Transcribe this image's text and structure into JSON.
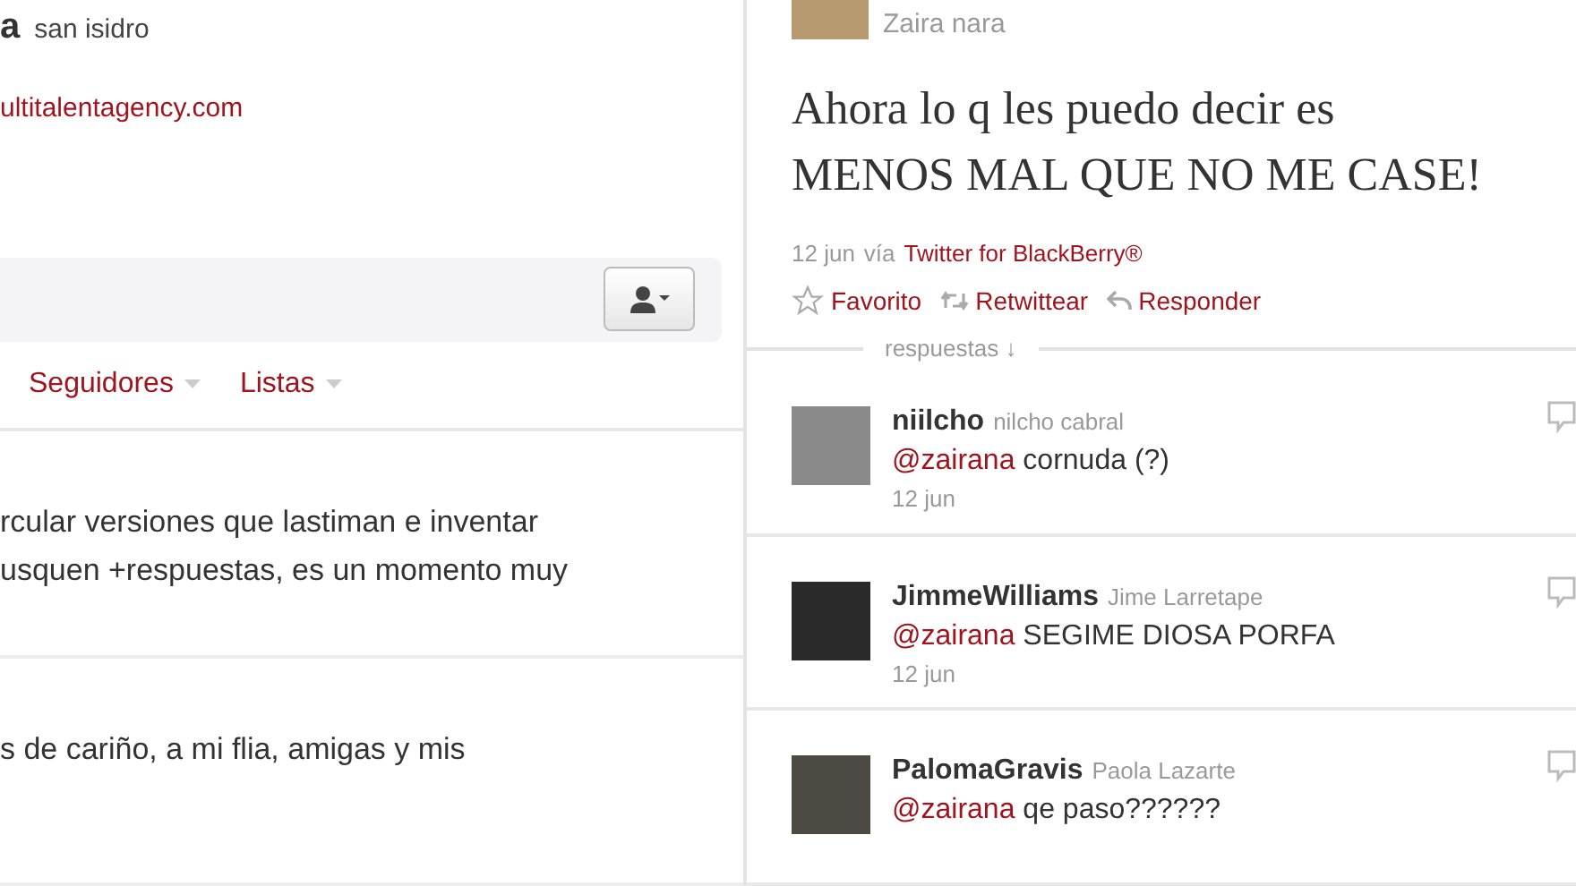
{
  "profile": {
    "name_fragment": "a",
    "location": "san isidro",
    "link": "ultitalentagency.com"
  },
  "profile_tabs": [
    {
      "label": "Seguidores",
      "selected": false
    },
    {
      "label": "Listas",
      "selected": false
    }
  ],
  "timeline": [
    {
      "text": "rcular versiones que lastiman e inventar\nusquen +respuestas, es un momento muy"
    },
    {
      "text": "s de cariño, a mi flia, amigas y mis"
    }
  ],
  "tweet": {
    "display_name": "Zaira nara",
    "text": "Ahora lo q les puedo decir es\nMENOS MAL QUE NO ME CASE!",
    "date": "12 jun",
    "via": "vía",
    "source": "Twitter for BlackBerry®",
    "actions": [
      {
        "kind": "favorite",
        "label": "Favorito"
      },
      {
        "kind": "retweet",
        "label": "Retwittear"
      },
      {
        "kind": "reply",
        "label": "Responder"
      }
    ],
    "replies_label": "respuestas ↓"
  },
  "replies": [
    {
      "username": "niilcho",
      "name": "nilcho cabral",
      "mention": "@zairana",
      "text": "cornuda (?)",
      "date": "12 jun"
    },
    {
      "username": "JimmeWilliams",
      "name": "Jime Larretape",
      "mention": "@zairana",
      "text": "SEGIME DIOSA PORFA",
      "date": "12 jun"
    },
    {
      "username": "PalomaGravis",
      "name": "Paola Lazarte",
      "mention": "@zairana",
      "text": "qe paso??????"
    }
  ]
}
